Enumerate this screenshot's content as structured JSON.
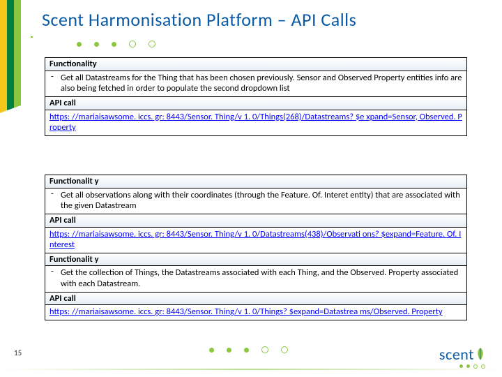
{
  "title": "Scent Harmonisation Platform – API Calls",
  "page_number": "15",
  "logo_text": "scent",
  "card1": {
    "h1": "Functionality",
    "b1": "Get all Datastreams for the Thing that has been chosen previously. Sensor and Observed Property entities info are also being fetched in order to populate the second dropdown list",
    "h2": "API call",
    "b2": "https: //mariaisawsome. iccs. gr: 8443/Sensor. Thing/v 1. 0/Things(268)/Datastreams? $e xpand=Sensor, Observed. Property"
  },
  "card2": {
    "h1": "Functionalit y",
    "b1": "Get all observations along with their coordinates (through the Feature. Of. Interet entity) that are associated with the given Datastream",
    "h2": "API call",
    "b2": "https: //mariaisawsome. iccs. gr: 8443/Sensor. Thing/v 1. 0/Datastreams(438)/Observati ons? $expand=Feature. Of. Interest",
    "h3": "Functionalit y",
    "b3": "Get the collection of Things, the Datastreams associated with each Thing, and the Observed. Property associated with each Datastream.",
    "h4": "API call",
    "b4": "https: //mariaisawsome. iccs. gr: 8443/Sensor. Thing/v 1. 0/Things? $expand=Datastrea ms/Observed. Property"
  }
}
